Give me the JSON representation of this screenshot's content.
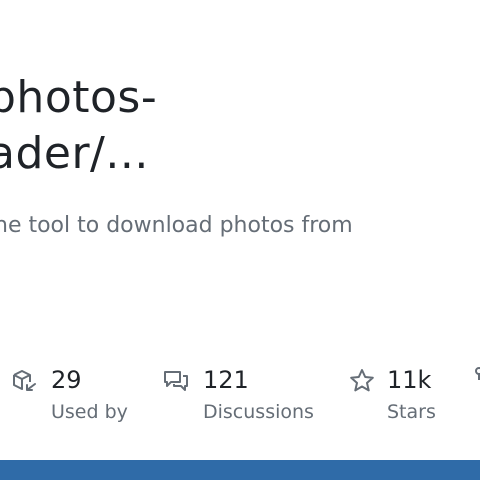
{
  "repo": {
    "title_line1": "photos-",
    "title_line2": "ader/...",
    "description": "ne tool to download photos from"
  },
  "stats": [
    {
      "value": "29",
      "label": "Used by",
      "icon": "package-dependents-icon"
    },
    {
      "value": "121",
      "label": "Discussions",
      "icon": "comment-discussion-icon"
    },
    {
      "value": "11k",
      "label": "Stars",
      "icon": "star-icon"
    }
  ],
  "colors": {
    "bottom_bar": "#2f6ba8",
    "text_primary": "#1f2328",
    "text_muted": "#656d76"
  }
}
